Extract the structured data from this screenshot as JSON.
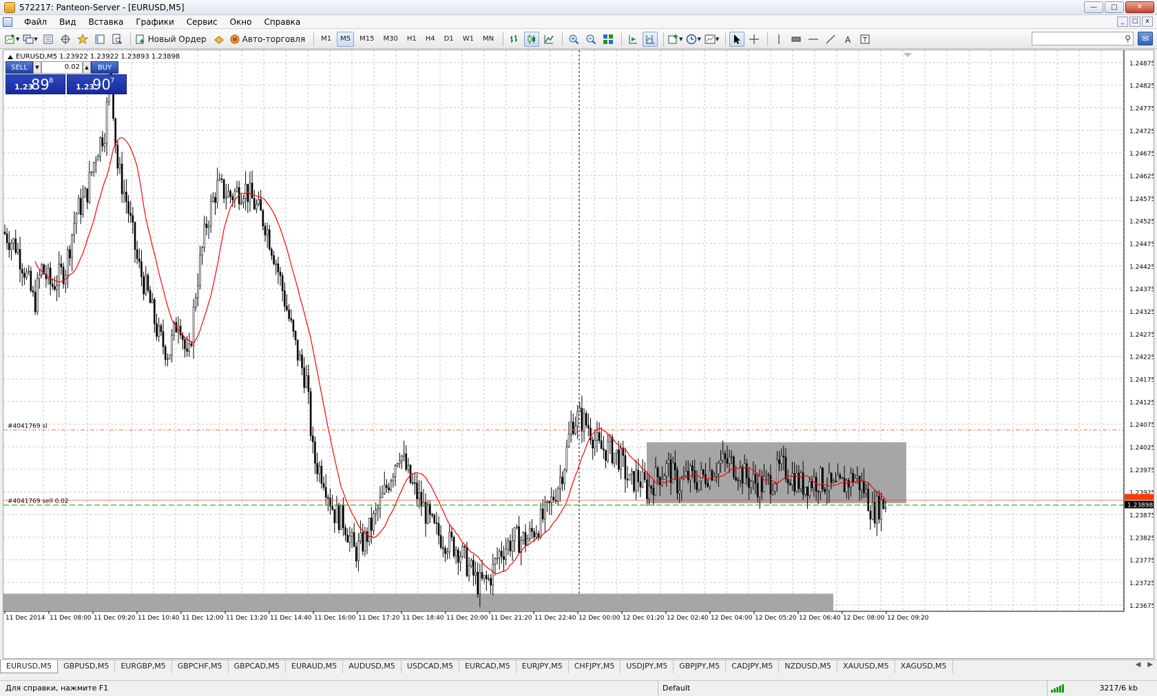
{
  "window": {
    "title": "572217: Panteon-Server - [EURUSD,M5]",
    "buttons": [
      "minimize",
      "maximize",
      "close"
    ]
  },
  "menu": {
    "items": [
      "Файл",
      "Вид",
      "Вставка",
      "Графики",
      "Сервис",
      "Окно",
      "Справка"
    ]
  },
  "toolbar": {
    "new_order_label": "Новый Ордер",
    "autotrade_label": "Авто-торговля",
    "periods": [
      "M1",
      "M5",
      "M15",
      "M30",
      "H1",
      "H4",
      "D1",
      "W1",
      "MN"
    ],
    "active_period": "M5",
    "search_placeholder": ""
  },
  "chart": {
    "symbol_label": "EURUSD,M5  1.23922 1.23922 1.23893 1.23898",
    "price_levels": [
      "1.24875",
      "1.24825",
      "1.24775",
      "1.24725",
      "1.24675",
      "1.24625",
      "1.24575",
      "1.24525",
      "1.24475",
      "1.24425",
      "1.24375",
      "1.24325",
      "1.24275",
      "1.24225",
      "1.24175",
      "1.24125",
      "1.24075",
      "1.24025",
      "1.23975",
      "1.23925",
      "1.23875",
      "1.23825",
      "1.23775",
      "1.23725",
      "1.23675"
    ],
    "time_labels": [
      "11 Dec 2014",
      "11 Dec 08:00",
      "11 Dec 09:20",
      "11 Dec 10:40",
      "11 Dec 12:00",
      "11 Dec 13:20",
      "11 Dec 14:40",
      "11 Dec 16:00",
      "11 Dec 17:20",
      "11 Dec 18:40",
      "11 Dec 20:00",
      "11 Dec 21:20",
      "11 Dec 22:40",
      "12 Dec 00:00",
      "12 Dec 01:20",
      "12 Dec 02:40",
      "12 Dec 04:00",
      "12 Dec 05:20",
      "12 Dec 06:40",
      "12 Dec 08:00",
      "12 Dec 09:20"
    ],
    "current_price": "1.23898",
    "current_price_value": 1.23898,
    "ask_price_value": 1.23907,
    "sl_line_label": "#4041769 sl",
    "sl_line_price": 1.24062,
    "order_line_label": "#4041769 sell 0.02",
    "order_line_price": 1.23896,
    "colors": {
      "candle": "#000000",
      "ma": "#ff0000",
      "sl_line": "#ff6a3d",
      "order_line": "#1da81d",
      "rect": "#a6a6a6",
      "grid": "#c8c8c8",
      "price_marker": "#ff3a00"
    }
  },
  "one_click": {
    "sell_label": "SELL",
    "buy_label": "BUY",
    "volume": "0.02",
    "sell_prefix": "1.23",
    "sell_big": "89",
    "sell_sup": "8",
    "buy_prefix": "1.23",
    "buy_big": "90",
    "buy_sup": "7"
  },
  "symbol_tabs": [
    "EURUSD,M5",
    "GBPUSD,M5",
    "EURGBP,M5",
    "GBPCHF,M5",
    "GBPCAD,M5",
    "EURAUD,M5",
    "AUDUSD,M5",
    "USDCAD,M5",
    "EURCAD,M5",
    "EURJPY,M5",
    "CHFJPY,M5",
    "USDJPY,M5",
    "GBPJPY,M5",
    "CADJPY,M5",
    "NZDUSD,M5",
    "XAUUSD,M5",
    "XAGUSD,M5"
  ],
  "active_tab": "EURUSD,M5",
  "status": {
    "help": "Для справки, нажмите F1",
    "profile": "Default",
    "traffic": "3217/6 kb"
  }
}
